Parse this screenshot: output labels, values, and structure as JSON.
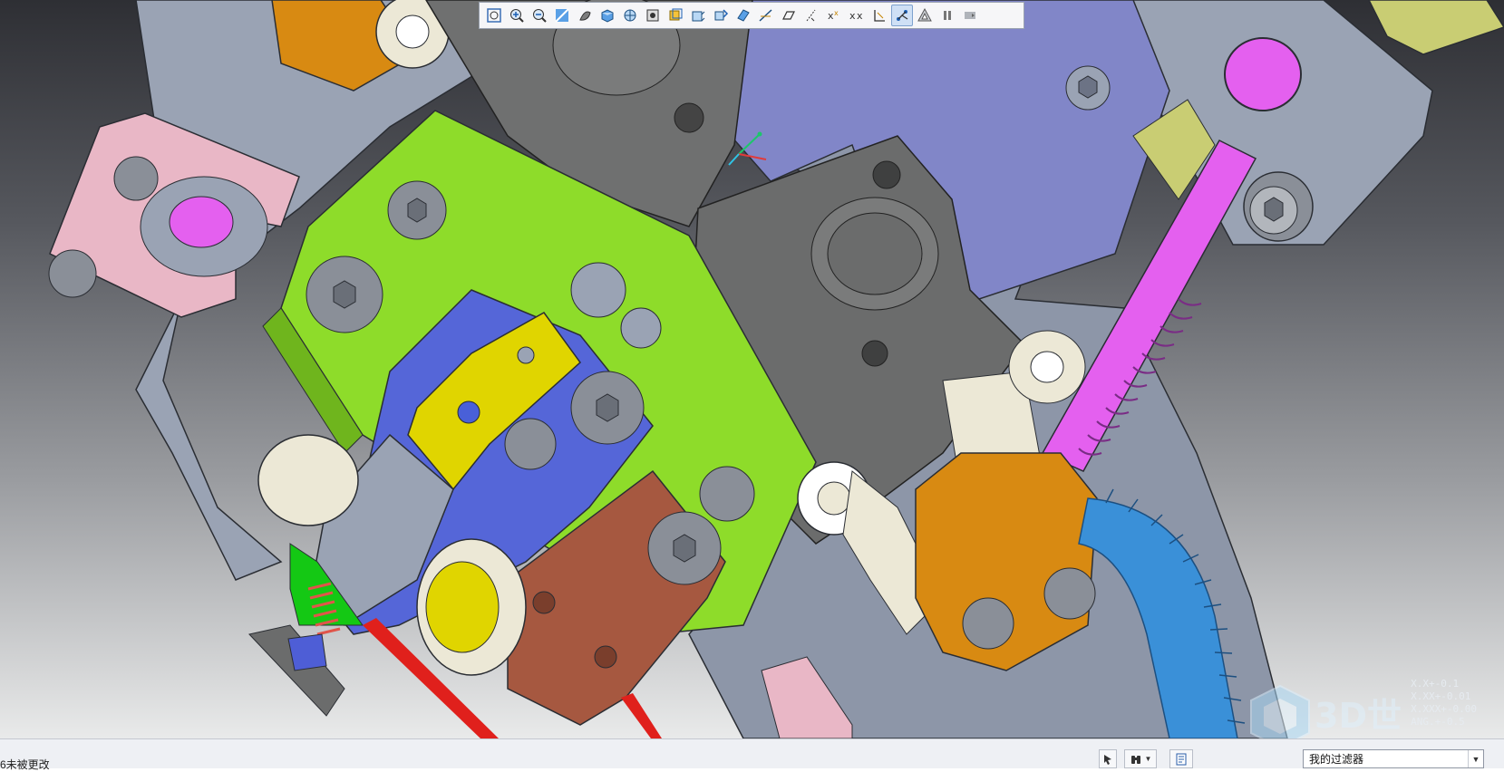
{
  "toolbar": {
    "items": [
      {
        "id": "refit",
        "icon": "zoom-fit-icon"
      },
      {
        "id": "zoom-in",
        "icon": "zoom-in-icon"
      },
      {
        "id": "zoom-out",
        "icon": "zoom-out-icon"
      },
      {
        "id": "repaint",
        "icon": "repaint-icon"
      },
      {
        "id": "display-style",
        "icon": "shaded-icon"
      },
      {
        "id": "saved-views",
        "icon": "saved-view-icon"
      },
      {
        "id": "view-manager",
        "icon": "view-manager-icon"
      },
      {
        "id": "appearance",
        "icon": "appearance-icon"
      },
      {
        "id": "layers",
        "icon": "layers-icon"
      },
      {
        "id": "perspective",
        "icon": "perspective-icon"
      },
      {
        "id": "section",
        "icon": "section-icon"
      },
      {
        "id": "datum-display",
        "icon": "datum-display-icon"
      },
      {
        "id": "plane-display",
        "icon": "plane-display-icon"
      },
      {
        "id": "axis-display",
        "icon": "axis-display-icon"
      },
      {
        "id": "point-display",
        "icon": "point-display-icon"
      },
      {
        "id": "csys-display",
        "icon": "csys-display-icon"
      },
      {
        "id": "csys-tag",
        "icon": "csys-tag-icon"
      },
      {
        "id": "annotation-display",
        "icon": "annotation-display-icon"
      },
      {
        "id": "spin-center",
        "icon": "spin-center-icon",
        "active": true
      },
      {
        "id": "simplified",
        "icon": "simplified-rep-icon"
      },
      {
        "id": "pause",
        "icon": "pause-icon"
      },
      {
        "id": "more",
        "icon": "more-icon"
      }
    ]
  },
  "tolerance": {
    "lines": [
      "X.X+-0.1",
      "X.XX+-0.01",
      "X.XXX+-0.00",
      "ANG.+-0.5"
    ]
  },
  "watermark": {
    "text": "3D世"
  },
  "status": {
    "message": "6未被更改",
    "filter_value": "我的过滤器"
  },
  "colors": {
    "toolbar_bg": "#f6f6f8",
    "status_bg": "#eef0f4",
    "active_button": "#cfe0f5"
  }
}
